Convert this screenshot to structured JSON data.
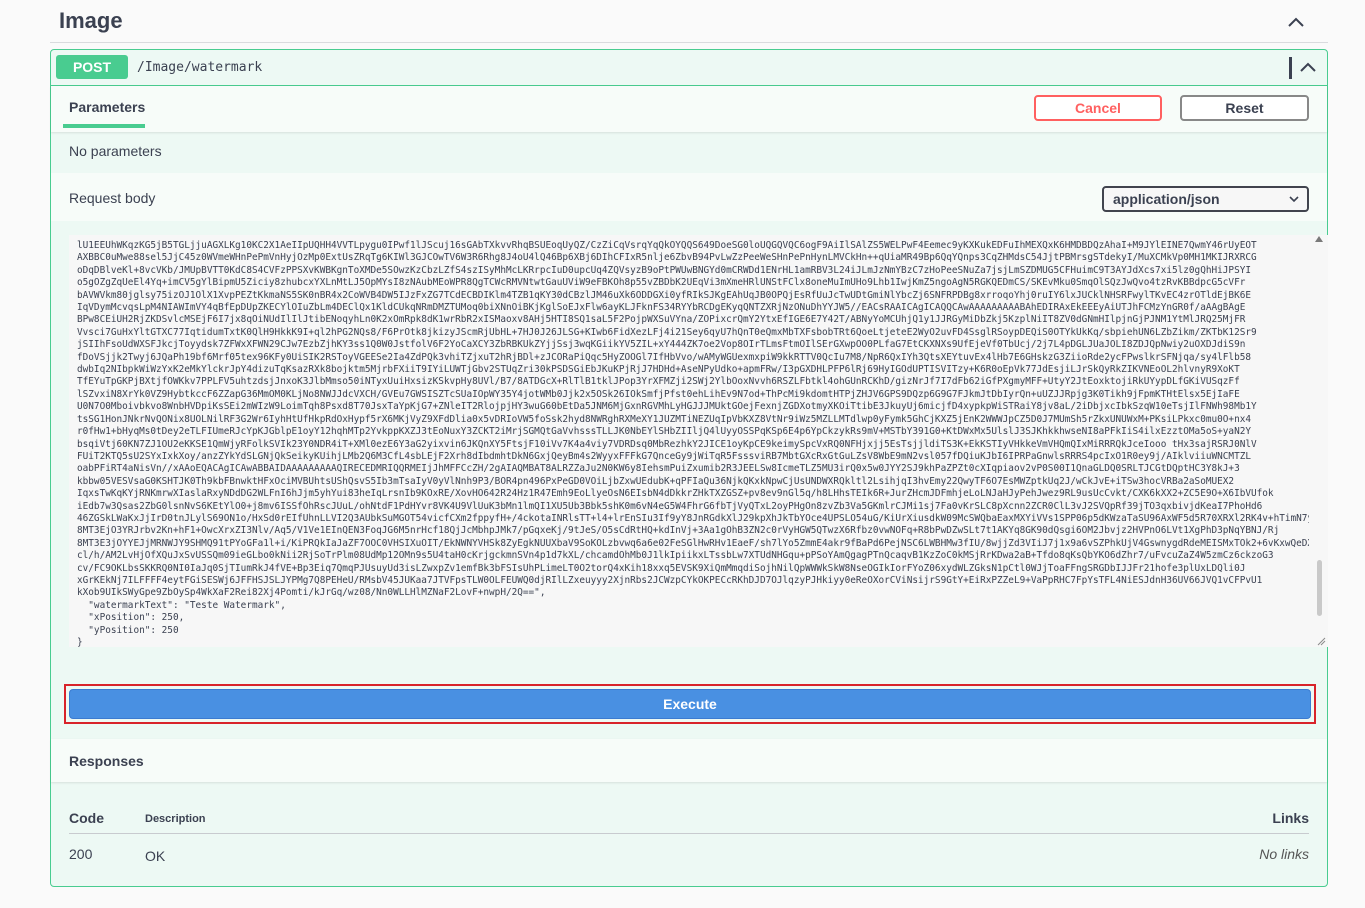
{
  "tag": {
    "title": "Image"
  },
  "operation": {
    "method": "POST",
    "path": "/Image/watermark"
  },
  "parameters": {
    "tab_label": "Parameters",
    "cancel_label": "Cancel",
    "reset_label": "Reset",
    "empty_text": "No parameters"
  },
  "request_body": {
    "label": "Request body",
    "content_type": "application/json",
    "code_lines": [
      "lU1EEUhWKqzKG5jB5TGLjjuAGXLKg10KC2X1AeIIpUQHH4VVTLpygu0IPwf1lJScuj16sGAbTXkvvRhqBSUEoqUyQZ/CzZiCqVsrqYqQkOYQQS649DoeSG0loUQGQVQC6ogF9AiIlSAlZS5WELPwF4Eemec9yKXKukEDFuIhMEXQxK6HMDBDQzAhaI+M9JYlEINE7QwmY46rUyEOT",
      "AXBBC0uMwe88sel5JjC45z0WVmeWHnPePmVnHyjOzMp0ExtUsZRqTg6KIWl3GJCOwTV6W3R6Rhg8J4oU4lQ46Bp6XBj6DIhCFIxR5nlje6ZbvB94PvLwZzPeeWeSHnPePnHynLMVCkHn++qUiaMR49Bp6QqYQnps3CqZHMdsC54JjtPBMrsgSTdekyI/MuXCMkVp0MH1MKIJRXRCG",
      "oDqDBlveKl+8vcVKb/JMUpBVTT0KdC8S4CVFzPPSXvKWBKgnToXMDe5SOwzKzCbzLZfS4szISyMhMcLKRrpcIuD0upcUq4ZQVsyzB9oPtPWUwBNGYd0mCRWDd1ENrHL1amRBV3L24iJLmJzNmYBzC7zHoPeeSNuZa7jsjLmSZDMUG5CFHuimC9T3AYJdXcs7xi5lz0gQhHiJPSYI",
      "o5gOZgZqUeEl4Yq+imCV5gYlBipmU5Ziciy8zhubcxYXLnMtLJ5OpMYsI8zNAubMEoWPR8QgTCWcRMVNtwtGauUViW9eFBKOh8p55vZBDbK2UEqVi3mXmeHRlUNStFClx8oneMuImUHo9Lhb1IwjKmZ5ngoAgN5RGKQEDmCS/SKEvMku0SmqOlSQzJwQvo4tzRvKBBdpcG5cVFr",
      "bAVWVkm80jglsy75izOJ1OlX1XvpPEZtKkmaNS5SK0nBR4x2CoWVB4DW5IJzFxZG7TCdECBDIKlm4TZB1qKY30dCBzlJM46uXk6ODDGXi0yfRIkSJKgEAhUqJB0OPQjEsRfUuJcTwUDtGmiNlYbcZj6SNFRPDBg8xrroqoYhj0ruIY6lxJUCklNHSRFwylTKvEC4zrOTldEjBK6E",
      "IqVDymMcvqsLpM4NIAWImVY4qBfEpDUpZKECYlOIuZbLm4DEClQx1KldCUkqNRmDMZTUMoq0biXNnOiBKjKglSoEJxFlw6ayKLJFknFS34RYYbRCDgEKyqQNTZXRjNzONuDhYYJW5//EACsRAAICAgICAQQCAwAAAAAAAAABAhEDIRAxEkEEEyAiUTJhFCMzYnGR0f/aAAgBAgE",
      "BPw8CEiUH2RjZKDSvlcMSEjF6I7jx8qOiNUdIlIlJtibENoqyhLn0K2xOmRpk8dK1wrRbR2xISMaoxv8AHj5HTI8SQ1saL5F2PojpWXSuVYna/ZOPixcrQmY2YtxEfIGE6E7Y42T/ABNyYoMCUhjQ1y1JJRGyMiDbZkj5KzplNiIT8ZV0dGNmHIlpjnGjPJNM1YtMlJRQ25MjFR",
      "Vvsci7GuHxYltGTXC77IqtidumTxtK0QlH9HkkK9I+ql2hPG2NQs8/F6PrOtk8jkizyJScmRjUbHL+7HJ0J26JLSG+KIwb6FidXezLFj4i21Sey6qyU7hQnT0eQmxMbTXFsbobTRt6QoeLtjeteE2WyO2uvFD4SsglRSoypDEQiS0OTYkUkKq/sbpiehUN6LZbZikm/ZKTbK12Sr9",
      "jSIIhFsoUdWXSFJkcjToyydsk7ZFWxXFWN29CJw7EzbZjhKY3ss1Q0W0JstfolV6F2YoCaXCY3ZbRBKUkZYjjSsj3wqKGiikYV5ZIL+xY444ZK7oe2Vop8OIrTLmsFtmOIlSErGXwpOO0PLfaG7EtCKXNXs9UfEjeVf0TbUcj/2j7L4pDGLJUaJOLI8ZDJQpNwiy2uOXDJdiS9n",
      "fDoVSjjk2Twyj6JQaPh19bf6Mrf05tex96KFy0UiSIK2RSToyVGEESe2Ia4ZdPQk3vhiTZjxuT2hRjBDl+zJCORaPiQqc5HyZOOGl7IfHbVvo/wAMyWGUexmxpiW9kkRTTV0QcIu7M8/NpR6QxIYh3QtsXEYtuvEx4lHb7E6GHskzG3ZiioRde2ycFPwslkrSFNjqa/sy4lFlb58",
      "dwbIq2NIbpkWiWzYxK2eMkYlckrJpY4dizuTqKsazRXk8bojktm5MjrbFXiiT9IYiLUWTjGbv2STUqZri30kPSDSGiEbJKuKPjRjJ7HDHd+AseNPyUdko+apmFRw/I3pGXDHLPFP6lRj69HyIGOdUPTISVITzy+K6R0oEpVk77JdEsjiLJrSkQyRkZIKVNEoOL2hlvnyR9XoKT",
      "TfEYuTpGKPjBXtjfOWKkv7PPLFV5uhtzdsjJnxoK3JlbMmso50iNTyxUuiHxsizKSkvpHy8UVl/B7/8ATDGcX+RlTlB1tklJPop3YrXFMZji2SWj2YlbOoxNvvh6RSZLFbtkl4ohGUnRCKhD/gizNrJf7I7dFb62iGfPXgmyMFF+UtyY2JtEoxktojiRkUYypDLfGKiVUSqzFf",
      "lSZvxiN8XrYk0VZ9HybtkccF6ZZapG36MmOM0KLjNo8NWJJdcVXCH/GVEu7GWSISZTcSUaIOpWY35Y4jotWMb0Jjk2x5OSk26IOkSmfjPfst0ehLihEv9N7od+ThPcMi9kdomtHTPjZHJV6GPS9DQzp6G9G7FJkmJtDbIyrQn+uUZJJRpjg3K0Tikh9jFpmKTHtElsx5EjIaFE",
      "U0N7O0Mboivbkvo8WnbHVDpiKsSEi2mWIzW9LoimTqh8Psxd8T70JsxTaYpKjG7+ZNleIT2RlojpjHY3wuG60bEtDa5JNM6MjGxnRGVMhLyHGJJJMUktGOejFexnjZGDXotmyXKOiTtibE3JkuyUj6micjfD4xypkpWiSTRaiY8jv8aL/2iDbjxcIbkSzqW10eTsjIlFNWh98Mb1Y",
      "tsSG1HonJNkrNvQONix8UOLNilRF3G2Wr6IyhHtUfHkpRdOxHypf5rX6MKjVyZ9XFdDlia0x5vDRIoVW5foSsk2hyd8NWRghRXMeXY1JUZMTiNEZUqIpVbKXZ8VtNr9iWz5MZLLMTdlwp0yFymk5GhCjKXZ5jEnK2WWWJpCZ5D0J7MUmSh5rZkxUNUWxM+PKsiLPkxc0mu0O+nx4",
      "r0fHw1+bHyqMs0tDey2eTLFIUmeRJcYpKJGblpE1oyY12hqhMTp2YvkppKXZJ3tEoNuxY3ZCKT2iMrjSGMQtGaVvhsssTLLJK0NbEYlSHbZIIljQ4lUyyOSSPqKSp6E4p6YpCkzykRs9mV+MSTbY391G0+KtDWxMx5UlslJ3SJKhkkhwseNI8aPFkIiS4ilxEzztOMa5oS+yaN2Y",
      "bsqiVtj60KN7ZJ1OU2eKKSE1QmWjyRFolkSVIk23Y0NDR4iT+XMl0ezE6Y3aG2yixvin6JKQnXY5FtsjF10iVv7K4a4viy7VDRDsq0MbRezhkY2JICE1oyKpCE9keimySpcVxRQ0NFHjxjj5EsTsjjldiTS3K+EkKSTIyVHkkeVmVHQmQIxMiRRRQkJceIooo tHx3sajRSRJ0NlV",
      "FUiT2KTQ5sU2SYxIxkXoy/anzZYkYdSLGNjQkSeikyKUihjLMb2Q6M3CfL4sbLEjF2Xrh8dIbdmhtDkN6GxjQeyBm4s2WyyxFFFkG7QnceGy9jWiTqR5FsssviRB7MbtGXcRxGtGuLZsV8WbE9mN2vsl057fDQiuKJbI6IPRPaGnwlsRRRS4pcIxO1R0ey9j/AIklviiuWNCMTZL",
      "oabPFiRT4aNisVn//xAAoEQACAgICAwABBAIDAAAAAAAAAQIRECEDMRIQQRMEIjJhMFFCcZH/2gAIAQMBAT8ALRZZaJu2N0KW6y8IehsmPuiZxumib2R3JEELSw8IcmeTLZ5MU3irQ0x5w0JYY2SJ9khPaZPZt0cXIqpiaov2vP0S00I1QnaGLDQ0SRLTJCGtDQptHC3Y8kJ+3",
      "kbbw05VESVsaG0KSHTJK0Th9kbFBnwktHFxOciMVBUhtsUShQsvS5Ib3mTsaIyV0yVlNnh9P3/BOR4pn496PxPeGD0VOiLjbZxwUEdubK+qPFIaQu36NjkQKxkNpwCjUsUNDWXRQkltl2LsihjqI3hvEmy22QwyTF6O7EsMWZptkUq2J/wCkJvE+iTSw3hocVRBa2aSoMUEX2",
      "IqxsTwKqKYjRNKmrwXIaslaRxyNDdDG2WLFnI6hJjm5yhYui83heIqLrsnIb9KOxRE/XovHO642R24Hz1R47Emh9EoLlyeOsN6EIsbN4dDkkrZHkTXZGSZ+pv8ev9nGl5q/h8LHhsTEIk6R+JurZHcmJDFmhjeLoLNJaHJyPehJwez9RL9usUcCvkt/CXK6kXX2+ZC5E9O+X6IbVUfok",
      "iEdb7w3Qsas2ZbG0lsnNvS6KEtYlO0+j8mv6ISSfOhRscJUuL/ohNtdF1PdHYvr8VK4U9VlUuK3bMn1lmQI1XU5Ub3Bbk5shK0m6vN4eG5W4FhrG6fbTjVyQTxL2oyPHgOn8zvZb3Va5GKmlrCJMi1sj7Fa0vKrSLC8pXcnn2ZCR0ClL3vJ2SVQpRf39jTO3qxbivjdKeaI7PhoHd6",
      "46ZGSkLWaKxJjIrD0tnJLylS69ON1o/HxSd0rEIfUhnLLVI2Q3AUbkSuMGOT54vicfCXm2fppyfH+/4ckotaINRlsTT+l4+lrEnSIu3If9yY8JnRGdkXlJ29kpXhJkTbYOce4UPSLO54uG/KiUrXiusdkW09McSWQbaEaxMXYiVVs1SPP06p5dKWzaTaSU96AxWF5d5R70XRXl2RK4v+hTimN7yJ",
      "8MT3EjO3YRJrbv2Kn+hF1+OwcXrxZI3Nlv/Aq5/V1Ve1EInQEN3FoqJG6M5nrHcf18QjJcMbhpJMk7/pGqxeKj/9tJeS/O5sCdRtHQ+kdInVj+3Aa1gOhB3ZN2c0rVyHGW5QTwzX6Rfbz0vwNOFq+R8bPwDZwSLt7t1AKYq8GK90dQsgi6OM2Jbvjz2HVPnO6LVt1XgPhD3pNqYBNJ/Rj",
      "8MT3E3jOYYEJjMRNWJY9SHMQ91tPYoGFa1l+i/KiPRQkIaJaZF7OOC0VHSIXuOIT/EkNWNYVHSk8ZyEgkNUUXbaV9SoKOLzbvwq6a6e02FeSGlHwRHv1EaeF/sh7lYo5ZmmE4akr9fBaPd6PejNSC6LWBHMw3fIU/8wjjZd3VIiJ7j1x9a6vSZPhkUjV4GswnygdRdeMEISMxTOk2+6vKxwQeDXE",
      "cl/h/AM2LvHjOfXQuJxSvUSSQm09ieGLbo0kNii2RjSoTrPlm08UdMp12OMn9s5U4taH0cKrjgckmnSVn4p1d7kXL/chcamdOhMb0J1lkIpiikxLTssbLw7XTUdNHGqu+pPSoYAmQgagPTnQcaqvB1KzZoC0kMSjRrKDwa2aB+Tfdo8qKsQbYKO6dZhr7/uFvcuZaZ4W5zmCz6ckzoG3",
      "cv/FC9OKLbsSKKRQ0NI0IaJq0SjTIumRkJ4fVE+Bp3Eiq7QmqPJUsuyUd3isLZwxpZv1emfBk3bFSIsUhPLimeLT0O2torQ4xKih18xxq5EVSK9XiQmMmqdiSojhNilQpWWWkSkW8NseOGIkIorFYoZ06xydWLZGksN1pCtl0WJjToaFFngSRGDbIJJFr21hofe3plUxLDQli0J",
      "xGrKEkNj7ILFFFF4eytFGiSESWj6JFFHSJSLJYPMg7Q8PEHeU/RMsbV45JUKaa7JTVFpsTLW0OLFEUWQ0djRIlLZxeuyyy2XjnRbs2JCWzpCYkOKPECcRKhDJD7OJlqzyPJHkiyy0eReOXorCViNsijrS9GtY+EiRxPZZeL9+VaPpRHC7FpYsTFL4NiESJdnH36UV66JVQ1vCFPvU1",
      "kXob9UIkSWyGpe9ZbOySp4WkXaF2Rei82Xj4Pomti/kJrGq/wz08/Nn0WLLHlMZNaF2LovF+nwpH/2Q==\",",
      "  \"watermarkText\": \"Teste Watermark\",",
      "  \"xPosition\": 250,",
      "  \"yPosition\": 250",
      "}"
    ]
  },
  "execute": {
    "label": "Execute"
  },
  "responses": {
    "title": "Responses",
    "headers": {
      "code": "Code",
      "description": "Description",
      "links": "Links"
    },
    "rows": [
      {
        "code": "200",
        "description": "OK",
        "links": "No links"
      }
    ]
  },
  "colors": {
    "post_green": "#49cc90",
    "cancel_red": "#ff6060",
    "execute_blue": "#4990e2",
    "highlight_red": "#d8232a"
  }
}
